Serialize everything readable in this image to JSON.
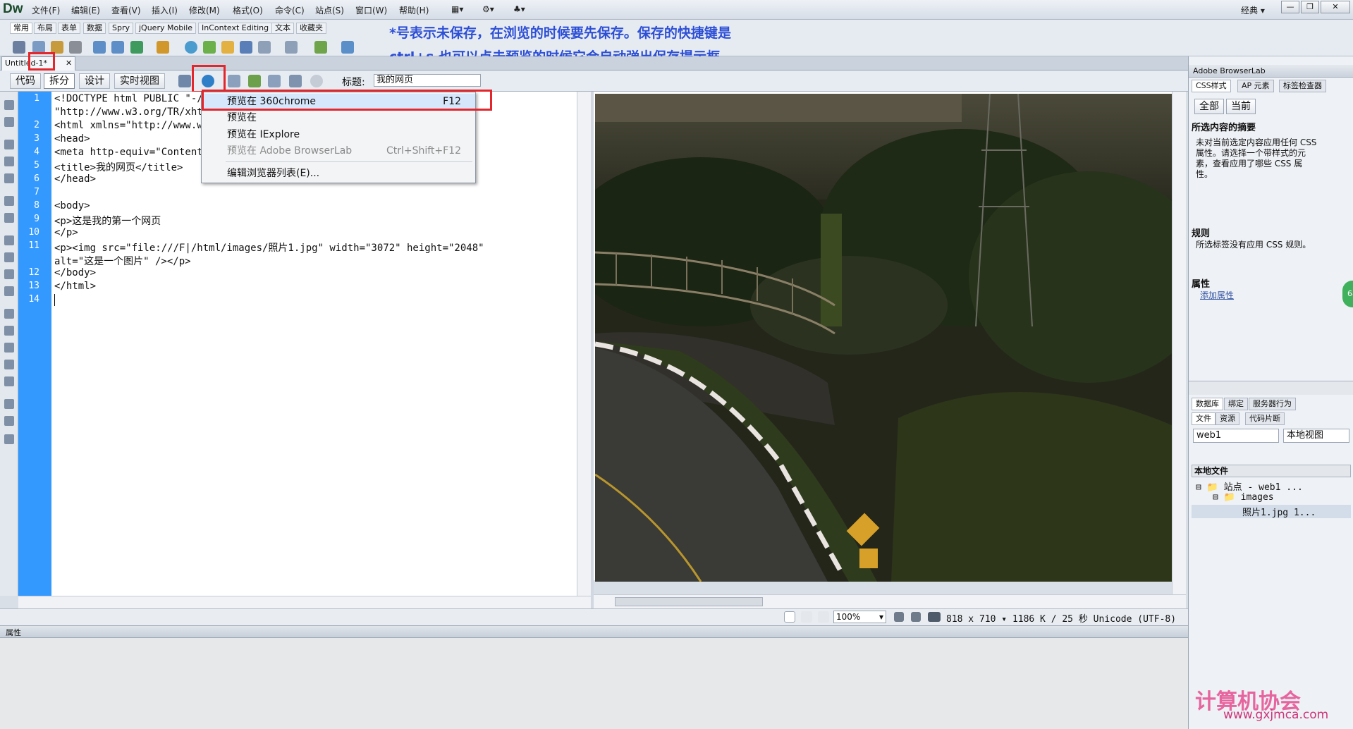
{
  "app": {
    "logo": "Dw",
    "workspace": "经典"
  },
  "menu": [
    "文件(F)",
    "编辑(E)",
    "查看(V)",
    "插入(I)",
    "修改(M)",
    "格式(O)",
    "命令(C)",
    "站点(S)",
    "窗口(W)",
    "帮助(H)"
  ],
  "insert_tabs": [
    "常用",
    "布局",
    "表单",
    "数据",
    "Spry",
    "jQuery Mobile",
    "InContext Editing",
    "文本",
    "收藏夹"
  ],
  "annotation": {
    "line1": "*号表示未保存，在浏览的时候要先保存。保存的快捷键是",
    "line2": "ctrl+s   也可以点击预览的时候它会自动弹出保存提示框"
  },
  "document": {
    "tab_label": "Untitled-1*",
    "title_label": "标题:",
    "title_value": "我的网页"
  },
  "view_buttons": [
    "代码",
    "拆分",
    "设计",
    "实时视图"
  ],
  "code_lines": [
    {
      "n": "1",
      "text": "<!DOCTYPE html PUBLIC \"-//W3C//DTD XHTML 1.0 Transitional//EN\""
    },
    {
      "n": "",
      "text": "\"http://www.w3.org/TR/xhtml1/DTD/xhtml1-transitional.dtd\">"
    },
    {
      "n": "2",
      "text": "<html xmlns=\"http://www.w3.org/1999/xhtml\">"
    },
    {
      "n": "3",
      "text": "<head>"
    },
    {
      "n": "4",
      "text": "<meta http-equiv=\"Content-Type\" content=\"text/html; charset=utf-8\" />"
    },
    {
      "n": "5",
      "text": "<title>我的网页</title>"
    },
    {
      "n": "6",
      "text": "</head>"
    },
    {
      "n": "7",
      "text": ""
    },
    {
      "n": "8",
      "text": "<body>"
    },
    {
      "n": "9",
      "text": "<p>这是我的第一个网页"
    },
    {
      "n": "10",
      "text": "</p>"
    },
    {
      "n": "11",
      "text": "<p><img src=\"file:///F|/html/images/照片1.jpg\" width=\"3072\" height=\"2048\""
    },
    {
      "n": "",
      "text": "alt=\"这是一个图片\" /></p>"
    },
    {
      "n": "12",
      "text": "</body>"
    },
    {
      "n": "13",
      "text": "</html>"
    },
    {
      "n": "14",
      "text": ""
    }
  ],
  "preview_menu": {
    "items": [
      {
        "label": "预览在 360chrome",
        "shortcut": "F12"
      },
      {
        "label": "预览在",
        "shortcut": ""
      },
      {
        "label": "预览在 IExplore",
        "shortcut": ""
      },
      {
        "label": "预览在 Adobe BrowserLab",
        "shortcut": "Ctrl+Shift+F12"
      },
      {
        "label": "编辑浏览器列表(E)...",
        "shortcut": ""
      }
    ]
  },
  "statusbar": {
    "zoom": "100%",
    "info": "818 x 710 ▾ 1186 K / 25 秒 Unicode (UTF-8)"
  },
  "properties_panel": {
    "title": "属性"
  },
  "right_panel": {
    "browserlab": "Adobe BrowserLab",
    "css_tabs": [
      "CSS样式",
      "AP 元素",
      "标签检查器"
    ],
    "css_buttons": [
      "全部",
      "当前"
    ],
    "summary_title": "所选内容的摘要",
    "summary_text": [
      "未对当前选定内容应用任何 CSS",
      "属性。请选择一个带样式的元",
      "素，查看应用了哪些 CSS 属",
      "性。"
    ],
    "rules_title": "规则",
    "rules_text": "所选标签没有应用 CSS 规则。",
    "props_title": "属性",
    "add_prop": "添加属性",
    "db_tabs": [
      "数据库",
      "绑定",
      "服务器行为"
    ],
    "file_tabs": [
      "文件",
      "资源",
      "代码片断"
    ],
    "site_select": "web1",
    "view_select": "本地视图",
    "local_files": "本地文件",
    "tree": [
      "站点 - web1 ...",
      "images",
      "照片1.jpg  1..."
    ],
    "badge": "68"
  },
  "watermark": {
    "text": "计算机协会",
    "url": "www.gxjmca.com"
  },
  "colors": {
    "gutter": "#3399ff",
    "annotation": "#2d4fd6",
    "highlight": "#e3262b"
  }
}
